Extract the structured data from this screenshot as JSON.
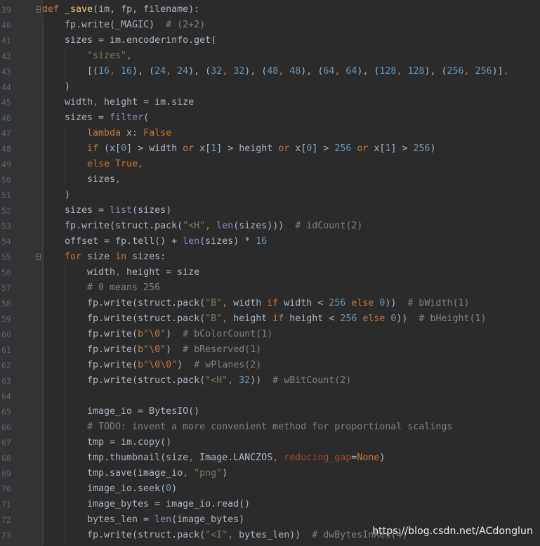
{
  "colors": {
    "background": "#2b2b2b",
    "gutter": "#313335",
    "line_number": "#606366",
    "default_text": "#a9b7c6",
    "keyword": "#cc7832",
    "function_name": "#ffc66d",
    "string": "#6a8759",
    "number": "#6897bb",
    "comment": "#808080",
    "builtin": "#8888c6",
    "parameter": "#aa4926"
  },
  "editor": {
    "fold_icons": [
      "fold-marker-icon"
    ],
    "lines": [
      {
        "num": "39",
        "indent": 0,
        "fold": true,
        "tokens": [
          [
            "kw",
            "def "
          ],
          [
            "fn",
            "_save"
          ],
          [
            "pl",
            "(im, fp, filename):"
          ]
        ]
      },
      {
        "num": "40",
        "indent": 1,
        "tokens": [
          [
            "pl",
            "fp.write(_MAGIC)  "
          ],
          [
            "cm",
            "# (2+2)"
          ]
        ]
      },
      {
        "num": "41",
        "indent": 1,
        "tokens": [
          [
            "pl",
            "sizes = im.encoderinfo.get("
          ]
        ]
      },
      {
        "num": "42",
        "indent": 2,
        "tokens": [
          [
            "str",
            "\"sizes\""
          ],
          [
            "kw",
            ","
          ]
        ]
      },
      {
        "num": "43",
        "indent": 2,
        "tokens": [
          [
            "pl",
            "[("
          ],
          [
            "num",
            "16"
          ],
          [
            "kw",
            ", "
          ],
          [
            "num",
            "16"
          ],
          [
            "pl",
            "), ("
          ],
          [
            "num",
            "24"
          ],
          [
            "kw",
            ", "
          ],
          [
            "num",
            "24"
          ],
          [
            "pl",
            "), ("
          ],
          [
            "num",
            "32"
          ],
          [
            "kw",
            ", "
          ],
          [
            "num",
            "32"
          ],
          [
            "pl",
            "), ("
          ],
          [
            "num",
            "48"
          ],
          [
            "kw",
            ", "
          ],
          [
            "num",
            "48"
          ],
          [
            "pl",
            "), ("
          ],
          [
            "num",
            "64"
          ],
          [
            "kw",
            ", "
          ],
          [
            "num",
            "64"
          ],
          [
            "pl",
            "), ("
          ],
          [
            "num",
            "128"
          ],
          [
            "kw",
            ", "
          ],
          [
            "num",
            "128"
          ],
          [
            "pl",
            "), ("
          ],
          [
            "num",
            "256"
          ],
          [
            "kw",
            ", "
          ],
          [
            "num",
            "256"
          ],
          [
            "pl",
            ")]"
          ],
          [
            "kw",
            ","
          ]
        ]
      },
      {
        "num": "44",
        "indent": 1,
        "tokens": [
          [
            "pl",
            ")"
          ]
        ]
      },
      {
        "num": "45",
        "indent": 1,
        "tokens": [
          [
            "pl",
            "width"
          ],
          [
            "kw",
            ", "
          ],
          [
            "pl",
            "height = im.size"
          ]
        ]
      },
      {
        "num": "46",
        "indent": 1,
        "tokens": [
          [
            "pl",
            "sizes = "
          ],
          [
            "bi",
            "filter"
          ],
          [
            "pl",
            "("
          ]
        ]
      },
      {
        "num": "47",
        "indent": 2,
        "tokens": [
          [
            "kw",
            "lambda "
          ],
          [
            "pl",
            "x: "
          ],
          [
            "kw",
            "False"
          ]
        ]
      },
      {
        "num": "48",
        "indent": 2,
        "tokens": [
          [
            "kw",
            "if "
          ],
          [
            "pl",
            "(x["
          ],
          [
            "num",
            "0"
          ],
          [
            "pl",
            "] > width "
          ],
          [
            "kw",
            "or "
          ],
          [
            "pl",
            "x["
          ],
          [
            "num",
            "1"
          ],
          [
            "pl",
            "] > height "
          ],
          [
            "kw",
            "or "
          ],
          [
            "pl",
            "x["
          ],
          [
            "num",
            "0"
          ],
          [
            "pl",
            "] > "
          ],
          [
            "num",
            "256 "
          ],
          [
            "kw",
            "or "
          ],
          [
            "pl",
            "x["
          ],
          [
            "num",
            "1"
          ],
          [
            "pl",
            "] > "
          ],
          [
            "num",
            "256"
          ],
          [
            "pl",
            ")"
          ]
        ]
      },
      {
        "num": "49",
        "indent": 2,
        "tokens": [
          [
            "kw",
            "else True,"
          ]
        ]
      },
      {
        "num": "50",
        "indent": 2,
        "tokens": [
          [
            "pl",
            "sizes"
          ],
          [
            "kw",
            ","
          ]
        ]
      },
      {
        "num": "51",
        "indent": 1,
        "tokens": [
          [
            "pl",
            ")"
          ]
        ]
      },
      {
        "num": "52",
        "indent": 1,
        "tokens": [
          [
            "pl",
            "sizes = "
          ],
          [
            "bi",
            "list"
          ],
          [
            "pl",
            "(sizes)"
          ]
        ]
      },
      {
        "num": "53",
        "indent": 1,
        "tokens": [
          [
            "pl",
            "fp.write(struct.pack("
          ],
          [
            "str",
            "\"<H\""
          ],
          [
            "kw",
            ", "
          ],
          [
            "bi",
            "len"
          ],
          [
            "pl",
            "(sizes)))  "
          ],
          [
            "cm",
            "# idCount(2)"
          ]
        ]
      },
      {
        "num": "54",
        "indent": 1,
        "tokens": [
          [
            "pl",
            "offset = fp.tell() + "
          ],
          [
            "bi",
            "len"
          ],
          [
            "pl",
            "(sizes) * "
          ],
          [
            "num",
            "16"
          ]
        ]
      },
      {
        "num": "55",
        "indent": 1,
        "fold": true,
        "tokens": [
          [
            "kw",
            "for "
          ],
          [
            "pl",
            "size "
          ],
          [
            "kw",
            "in "
          ],
          [
            "pl",
            "sizes:"
          ]
        ]
      },
      {
        "num": "56",
        "indent": 2,
        "tokens": [
          [
            "pl",
            "width"
          ],
          [
            "kw",
            ", "
          ],
          [
            "pl",
            "height = size"
          ]
        ]
      },
      {
        "num": "57",
        "indent": 2,
        "tokens": [
          [
            "cm",
            "# 0 means 256"
          ]
        ]
      },
      {
        "num": "58",
        "indent": 2,
        "tokens": [
          [
            "pl",
            "fp.write(struct.pack("
          ],
          [
            "str",
            "\"B\""
          ],
          [
            "kw",
            ", "
          ],
          [
            "pl",
            "width "
          ],
          [
            "kw",
            "if "
          ],
          [
            "pl",
            "width < "
          ],
          [
            "num",
            "256 "
          ],
          [
            "kw",
            "else "
          ],
          [
            "num",
            "0"
          ],
          [
            "pl",
            "))  "
          ],
          [
            "cm",
            "# bWidth(1)"
          ]
        ]
      },
      {
        "num": "59",
        "indent": 2,
        "tokens": [
          [
            "pl",
            "fp.write(struct.pack("
          ],
          [
            "str",
            "\"B\""
          ],
          [
            "kw",
            ", "
          ],
          [
            "pl",
            "height "
          ],
          [
            "kw",
            "if "
          ],
          [
            "pl",
            "height < "
          ],
          [
            "num",
            "256 "
          ],
          [
            "kw",
            "else "
          ],
          [
            "num",
            "0"
          ],
          [
            "pl",
            "))  "
          ],
          [
            "cm",
            "# bHeight(1)"
          ]
        ]
      },
      {
        "num": "60",
        "indent": 2,
        "tokens": [
          [
            "pl",
            "fp.write("
          ],
          [
            "kw",
            "b"
          ],
          [
            "str",
            "\""
          ],
          [
            "esc",
            "\\0"
          ],
          [
            "str",
            "\""
          ],
          [
            "pl",
            ")  "
          ],
          [
            "cm",
            "# bColorCount(1)"
          ]
        ]
      },
      {
        "num": "61",
        "indent": 2,
        "tokens": [
          [
            "pl",
            "fp.write("
          ],
          [
            "kw",
            "b"
          ],
          [
            "str",
            "\""
          ],
          [
            "esc",
            "\\0"
          ],
          [
            "str",
            "\""
          ],
          [
            "pl",
            ")  "
          ],
          [
            "cm",
            "# bReserved(1)"
          ]
        ]
      },
      {
        "num": "62",
        "indent": 2,
        "tokens": [
          [
            "pl",
            "fp.write("
          ],
          [
            "kw",
            "b"
          ],
          [
            "str",
            "\""
          ],
          [
            "esc",
            "\\0\\0"
          ],
          [
            "str",
            "\""
          ],
          [
            "pl",
            ")  "
          ],
          [
            "cm",
            "# wPlanes(2)"
          ]
        ]
      },
      {
        "num": "63",
        "indent": 2,
        "tokens": [
          [
            "pl",
            "fp.write(struct.pack("
          ],
          [
            "str",
            "\"<H\""
          ],
          [
            "kw",
            ", "
          ],
          [
            "num",
            "32"
          ],
          [
            "pl",
            "))  "
          ],
          [
            "cm",
            "# wBitCount(2)"
          ]
        ]
      },
      {
        "num": "64",
        "indent": 2,
        "tokens": []
      },
      {
        "num": "65",
        "indent": 2,
        "tokens": [
          [
            "pl",
            "image_io = BytesIO()"
          ]
        ]
      },
      {
        "num": "66",
        "indent": 2,
        "tokens": [
          [
            "cm",
            "# TODO: invent a more convenient method for proportional scalings"
          ]
        ]
      },
      {
        "num": "67",
        "indent": 2,
        "tokens": [
          [
            "pl",
            "tmp = im.copy()"
          ]
        ]
      },
      {
        "num": "68",
        "indent": 2,
        "tokens": [
          [
            "pl",
            "tmp.thumbnail(size"
          ],
          [
            "kw",
            ", "
          ],
          [
            "pl",
            "Image.LANCZOS"
          ],
          [
            "kw",
            ", "
          ],
          [
            "par",
            "reducing_gap"
          ],
          [
            "pl",
            "="
          ],
          [
            "kw",
            "None"
          ],
          [
            "pl",
            ")"
          ]
        ]
      },
      {
        "num": "69",
        "indent": 2,
        "tokens": [
          [
            "pl",
            "tmp.save(image_io"
          ],
          [
            "kw",
            ", "
          ],
          [
            "str",
            "\"png\""
          ],
          [
            "pl",
            ")"
          ]
        ]
      },
      {
        "num": "70",
        "indent": 2,
        "tokens": [
          [
            "pl",
            "image_io.seek("
          ],
          [
            "num",
            "0"
          ],
          [
            "pl",
            ")"
          ]
        ]
      },
      {
        "num": "71",
        "indent": 2,
        "tokens": [
          [
            "pl",
            "image_bytes = image_io.read()"
          ]
        ]
      },
      {
        "num": "72",
        "indent": 2,
        "tokens": [
          [
            "pl",
            "bytes_len = "
          ],
          [
            "bi",
            "len"
          ],
          [
            "pl",
            "(image_bytes)"
          ]
        ]
      },
      {
        "num": "73",
        "indent": 2,
        "tokens": [
          [
            "pl",
            "fp.write(struct.pack("
          ],
          [
            "str",
            "\"<I\""
          ],
          [
            "kw",
            ", "
          ],
          [
            "pl",
            "bytes_len))  "
          ],
          [
            "cm",
            "# dwBytesInRes(4)"
          ]
        ]
      }
    ]
  },
  "watermark": {
    "text": "https://blog.csdn.net/ACdonglun"
  }
}
